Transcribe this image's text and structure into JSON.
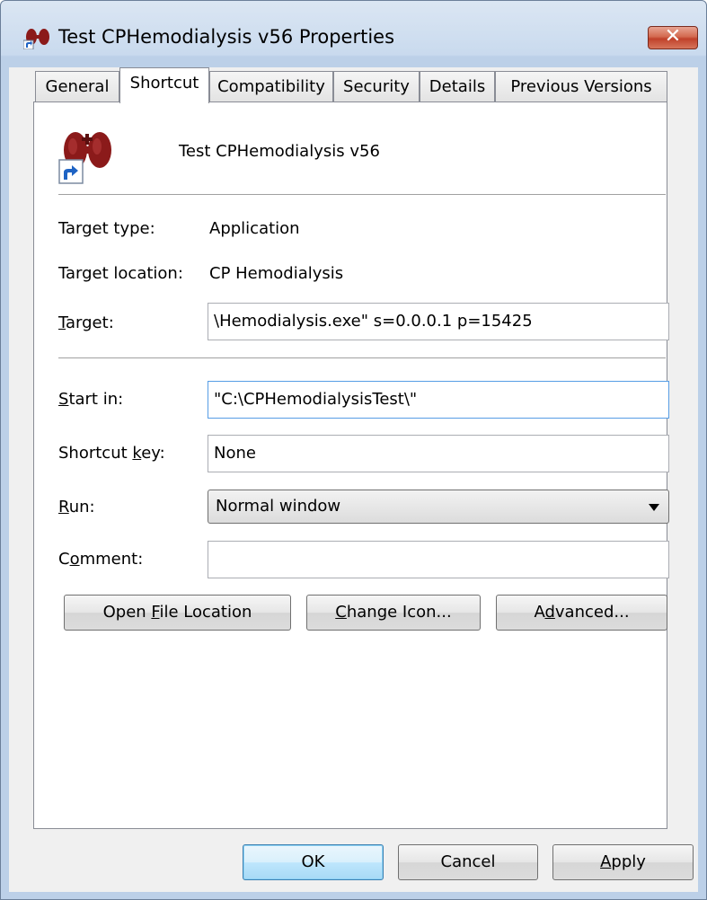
{
  "window": {
    "title": "Test CPHemodialysis v56 Properties"
  },
  "tabs": [
    {
      "label": "General"
    },
    {
      "label": "Shortcut"
    },
    {
      "label": "Compatibility"
    },
    {
      "label": "Security"
    },
    {
      "label": "Details"
    },
    {
      "label": "Previous Versions"
    }
  ],
  "shortcut": {
    "name": "Test CPHemodialysis v56",
    "target_type_label": "Target type:",
    "target_type_value": "Application",
    "target_location_label": "Target location:",
    "target_location_value": "CP Hemodialysis",
    "target_label_pre": "",
    "target_label_u": "T",
    "target_label_post": "arget:",
    "target_value": "\\Hemodialysis.exe\" s=0.0.0.1 p=15425",
    "start_in_label_u": "S",
    "start_in_label_post": "tart in:",
    "start_in_value": "\"C:\\CPHemodialysisTest\\\"",
    "shortcut_key_label_pre": "Shortcut ",
    "shortcut_key_label_u": "k",
    "shortcut_key_label_post": "ey:",
    "shortcut_key_value": "None",
    "run_label_u": "R",
    "run_label_post": "un:",
    "run_value": "Normal window",
    "comment_label_pre": "C",
    "comment_label_u": "o",
    "comment_label_post": "mment:",
    "comment_value": ""
  },
  "buttons": {
    "open_file_pre": "Open ",
    "open_file_u": "F",
    "open_file_post": "ile Location",
    "change_icon_u": "C",
    "change_icon_post": "hange Icon...",
    "advanced_pre": "A",
    "advanced_u": "d",
    "advanced_post": "vanced...",
    "ok": "OK",
    "cancel": "Cancel",
    "apply_u": "A",
    "apply_post": "pply"
  },
  "icons": {
    "app": "kidney-icon",
    "shortcut_overlay": "shortcut-arrow-icon",
    "close": "close-icon"
  },
  "colors": {
    "close_button": "#c0412a",
    "icon_red": "#8b1a1a",
    "default_button_border": "#3c7fb1"
  }
}
